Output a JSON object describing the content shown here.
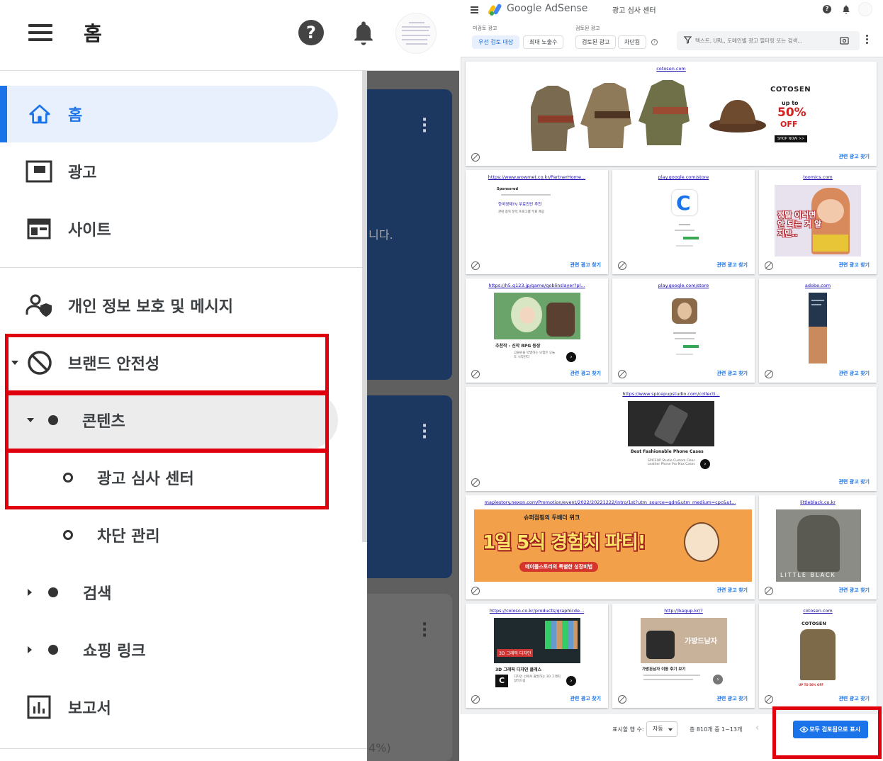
{
  "left": {
    "header": {
      "title": "홈"
    },
    "nav": {
      "home": "홈",
      "ads": "광고",
      "sites": "사이트",
      "privacy": "개인 정보 보호 및 메시지",
      "brand_safety": "브랜드 안전성",
      "content": "콘텐츠",
      "ad_review_center": "광고 심사 센터",
      "blocking_controls": "차단 관리",
      "search": "검색",
      "shopping_links": "쇼핑 링크",
      "reports": "보고서"
    },
    "background": {
      "fragment_text": "니다.",
      "fragment_pct": "4%)"
    }
  },
  "right": {
    "header": {
      "brand": "Google AdSense",
      "page_title": "광고 심사 센터"
    },
    "filters": {
      "unreviewed_label": "미검토 광고",
      "reviewed_label": "검토된 광고",
      "chips": [
        "우선 검토 대상",
        "최대 노출수",
        "검토된 광고",
        "차단됨"
      ],
      "search_placeholder": "텍스트, URL, 도메인별 광고 필터링 또는 검색..."
    },
    "find_related": "관련 광고 찾기",
    "cards": [
      {
        "url": "cotosen.com",
        "title": "COTOSEN",
        "promo_upto": "up to",
        "promo_pct": "50%",
        "promo_off": "OFF",
        "cta": "SHOP NOW >>"
      },
      {
        "url": "https://www.wowmet.co.kr/PartnerHome...",
        "sponsored": "Sponsored",
        "headline": "한국경제TV 무료진단 추천",
        "body": "관련 종목 분석 프로그램 무료 제공"
      },
      {
        "url": "play.google.com/store",
        "app": "C"
      },
      {
        "url": "toomics.com",
        "text": "정말 이러면 안 되는 거 알지만.."
      },
      {
        "url": "https://h5.g123.jp/game/goblinslayer?pl...",
        "headline": "추천작 - 신작 RPG 등장",
        "body": "고블린을 박멸하는 모험은 오늘도 시작된다"
      },
      {
        "url": "play.google.com/store"
      },
      {
        "url": "adobe.com"
      },
      {
        "url": "https://www.spicepupstudio.com/collecti...",
        "headline": "Best Fashionable Phone Cases",
        "body": "SPICEUP Studio Custom Clear Leather Phone Pro Max Cases"
      },
      {
        "url": "maplestory.nexon.com/Promotion/event/2022/20221222/intro/1st?utm_source=gdn&utm_medium=cpc&ut...",
        "tag": "슈퍼점핑의 두배더 위크",
        "headline": "1일 5식 경험치 파티!",
        "sub": "메이플스토리의 특별한 성장비법"
      },
      {
        "url": "littleblack.co.kr",
        "brand": "LITTLE BLACK"
      },
      {
        "url": "https://coloso.co.kr/products/graphicde...",
        "overlay": "3D 그래픽 디자인",
        "headline": "3D 그래픽 디자인 클래스",
        "body": "디자인 선에서 출발하는 3D 그래픽 알려드림"
      },
      {
        "url": "http://bagup.kr/?",
        "overlay": "가방드남자",
        "headline": "가방든남자 이동 후기 보기"
      },
      {
        "url": "cotosen.com",
        "brand": "COTOSEN",
        "promo": "UP TO 50% OFF"
      }
    ],
    "footer": {
      "rows_label": "표시할 행 수:",
      "rows_value": "자동",
      "range": "총 810개 중 1~13개",
      "prev": "‹",
      "show_all": "모두 검토됨으로 표시"
    }
  },
  "colors": {
    "accent": "#1a73e8",
    "highlight_red": "#e0000d",
    "active_bg": "#e8f0fe"
  }
}
